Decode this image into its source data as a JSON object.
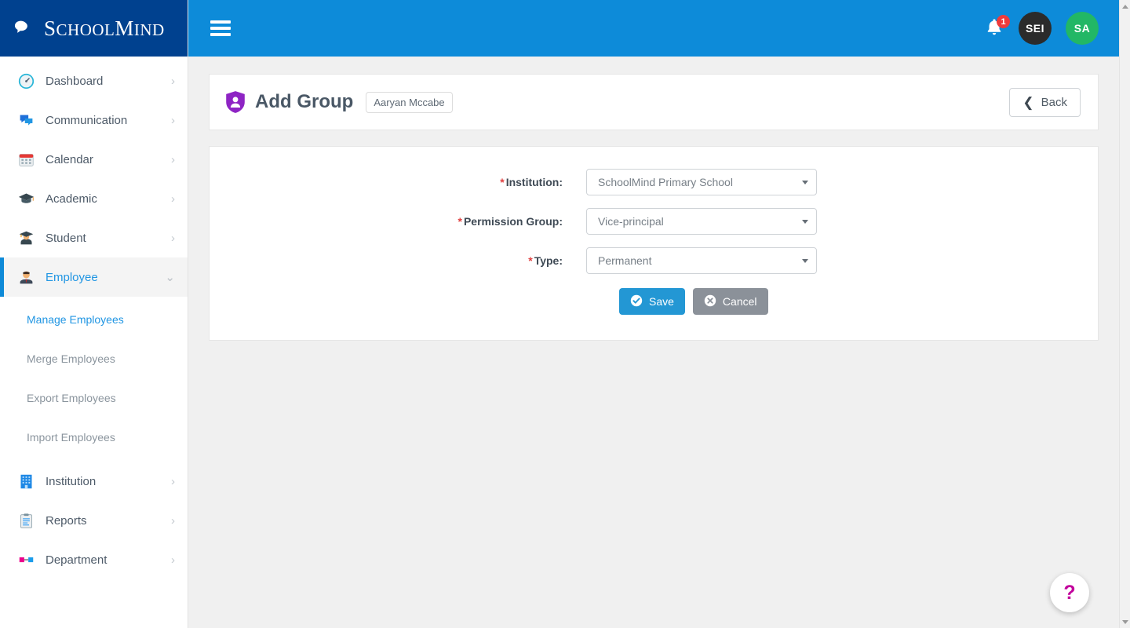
{
  "brand": {
    "name_small": "CHOOL",
    "name_cap1": "S",
    "name_cap2": "M",
    "name_small2": "IND",
    "icon": "cloud-speech-icon"
  },
  "topbar": {
    "menu_icon": "hamburger-icon",
    "notification_icon": "bell-icon",
    "notification_count": "1",
    "avatar_one": "SEI",
    "avatar_two": "SA"
  },
  "sidebar": {
    "items": [
      {
        "label": "Dashboard",
        "icon": "dashboard-icon",
        "chevron": "›"
      },
      {
        "label": "Communication",
        "icon": "communication-icon",
        "chevron": "›"
      },
      {
        "label": "Calendar",
        "icon": "calendar-icon",
        "chevron": "›"
      },
      {
        "label": "Academic",
        "icon": "academic-icon",
        "chevron": "›"
      },
      {
        "label": "Student",
        "icon": "student-icon",
        "chevron": "›"
      },
      {
        "label": "Employee",
        "icon": "employee-icon",
        "chevron": "⌄"
      },
      {
        "label": "Institution",
        "icon": "institution-icon",
        "chevron": "›"
      },
      {
        "label": "Reports",
        "icon": "reports-icon",
        "chevron": "›"
      },
      {
        "label": "Department",
        "icon": "department-icon",
        "chevron": "›"
      }
    ],
    "subitems": [
      {
        "label": "Manage Employees"
      },
      {
        "label": "Merge Employees"
      },
      {
        "label": "Export Employees"
      },
      {
        "label": "Import Employees"
      }
    ]
  },
  "page": {
    "title": "Add Group",
    "title_icon": "shield-user-icon",
    "name_badge": "Aaryan Mccabe",
    "back_label": "Back",
    "back_icon": "chevron-left-icon"
  },
  "form": {
    "fields": [
      {
        "required": "*",
        "label": "Institution:",
        "value": "SchoolMind Primary School"
      },
      {
        "required": "*",
        "label": "Permission Group:",
        "value": "Vice-principal"
      },
      {
        "required": "*",
        "label": "Type:",
        "value": "Permanent"
      }
    ],
    "save_label": "Save",
    "save_icon": "check-circle-icon",
    "cancel_label": "Cancel",
    "cancel_icon": "x-circle-icon"
  },
  "help": {
    "label": "?",
    "icon": "question-mark-icon"
  },
  "colors": {
    "brand_dark_blue": "#00418f",
    "header_blue": "#0d8bd9",
    "accent_blue": "#2196e3",
    "save_blue": "#2397d4",
    "cancel_gray": "#8b9199",
    "badge_red": "#ef3b3b",
    "avatar_green": "#22b765",
    "shield_purple": "#8e24c4",
    "help_magenta": "#c2009c",
    "required_red": "#e04141",
    "page_bg": "#f0f0f0"
  }
}
